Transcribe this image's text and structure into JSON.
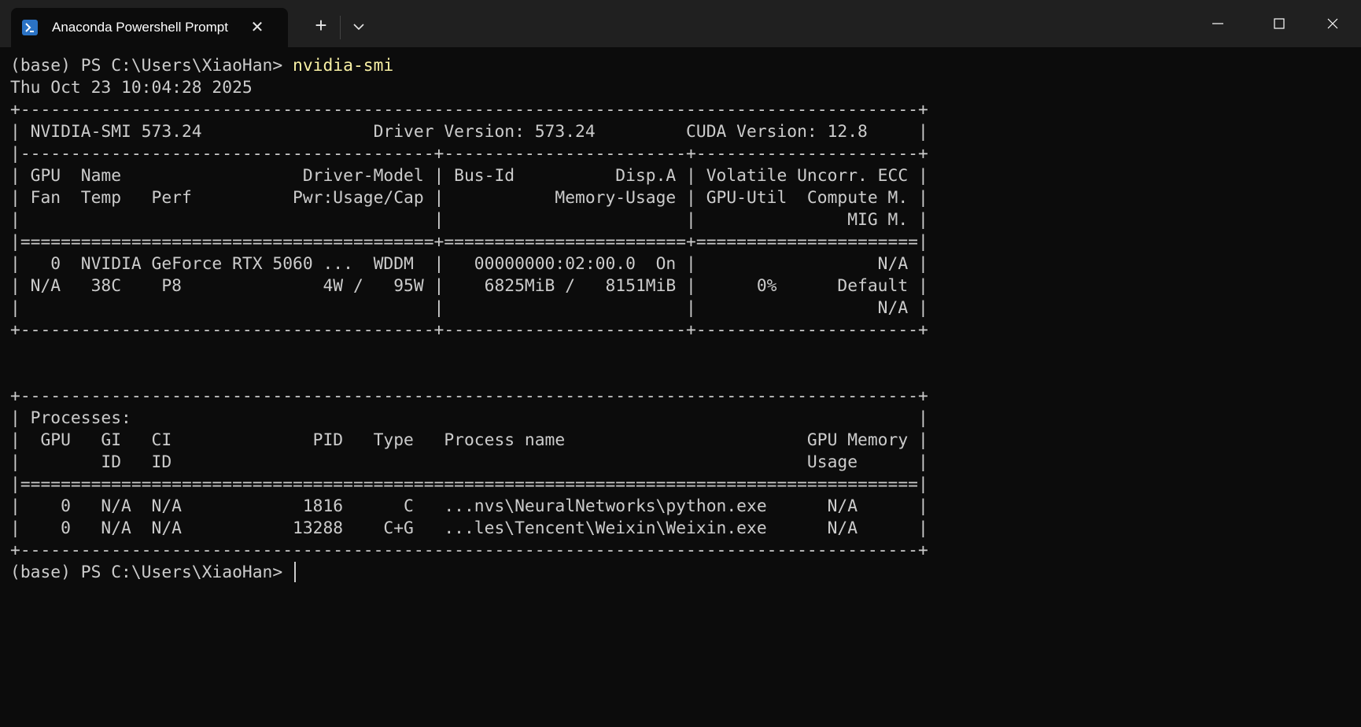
{
  "window": {
    "tab_title": "Anaconda Powershell Prompt",
    "new_tab_symbol": "+",
    "close_tab_symbol": "✕"
  },
  "colors": {
    "background": "#0c0c0c",
    "titlebar": "#202020",
    "text": "#cccccc",
    "command": "#f9f1a5",
    "tab_icon": "#2b73c5"
  },
  "icons": {
    "tab_icon": "powershell-icon",
    "dropdown": "chevron-down-icon",
    "minimize": "minimize-icon",
    "maximize": "maximize-icon",
    "close": "close-icon"
  },
  "terminal": {
    "prompt": "(base) PS C:\\Users\\XiaoHan> ",
    "command": "nvidia-smi",
    "lines": [
      "Thu Oct 23 10:04:28 2025",
      "+-----------------------------------------------------------------------------------------+",
      "| NVIDIA-SMI 573.24                 Driver Version: 573.24         CUDA Version: 12.8     |",
      "|-----------------------------------------+------------------------+----------------------+",
      "| GPU  Name                  Driver-Model | Bus-Id          Disp.A | Volatile Uncorr. ECC |",
      "| Fan  Temp   Perf          Pwr:Usage/Cap |           Memory-Usage | GPU-Util  Compute M. |",
      "|                                         |                        |               MIG M. |",
      "|=========================================+========================+======================|",
      "|   0  NVIDIA GeForce RTX 5060 ...  WDDM  |   00000000:02:00.0  On |                  N/A |",
      "| N/A   38C    P8              4W /   95W |    6825MiB /   8151MiB |      0%      Default |",
      "|                                         |                        |                  N/A |",
      "+-----------------------------------------+------------------------+----------------------+",
      "",
      "",
      "+-----------------------------------------------------------------------------------------+",
      "| Processes:                                                                              |",
      "|  GPU   GI   CI              PID   Type   Process name                        GPU Memory |",
      "|        ID   ID                                                               Usage      |",
      "|=========================================================================================|",
      "|    0   N/A  N/A            1816      C   ...nvs\\NeuralNetworks\\python.exe      N/A      |",
      "|    0   N/A  N/A           13288    C+G   ...les\\Tencent\\Weixin\\Weixin.exe      N/A      |",
      "+-----------------------------------------------------------------------------------------+"
    ],
    "final_prompt": "(base) PS C:\\Users\\XiaoHan> "
  }
}
